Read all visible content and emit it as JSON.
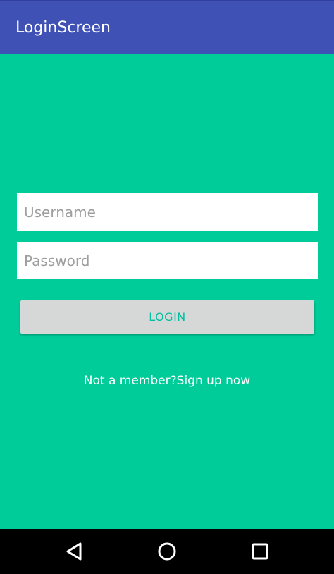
{
  "app_bar": {
    "title": "LoginScreen",
    "color": "#3F51B5"
  },
  "background_color": "#00CC99",
  "form": {
    "username_placeholder": "Username",
    "username_value": "",
    "password_placeholder": "Password",
    "password_value": "",
    "login_label": "LOGIN",
    "signup_text": "Not a member?Sign up now"
  },
  "nav_bar": {
    "icons": [
      "back-icon",
      "home-icon",
      "recents-icon"
    ]
  }
}
